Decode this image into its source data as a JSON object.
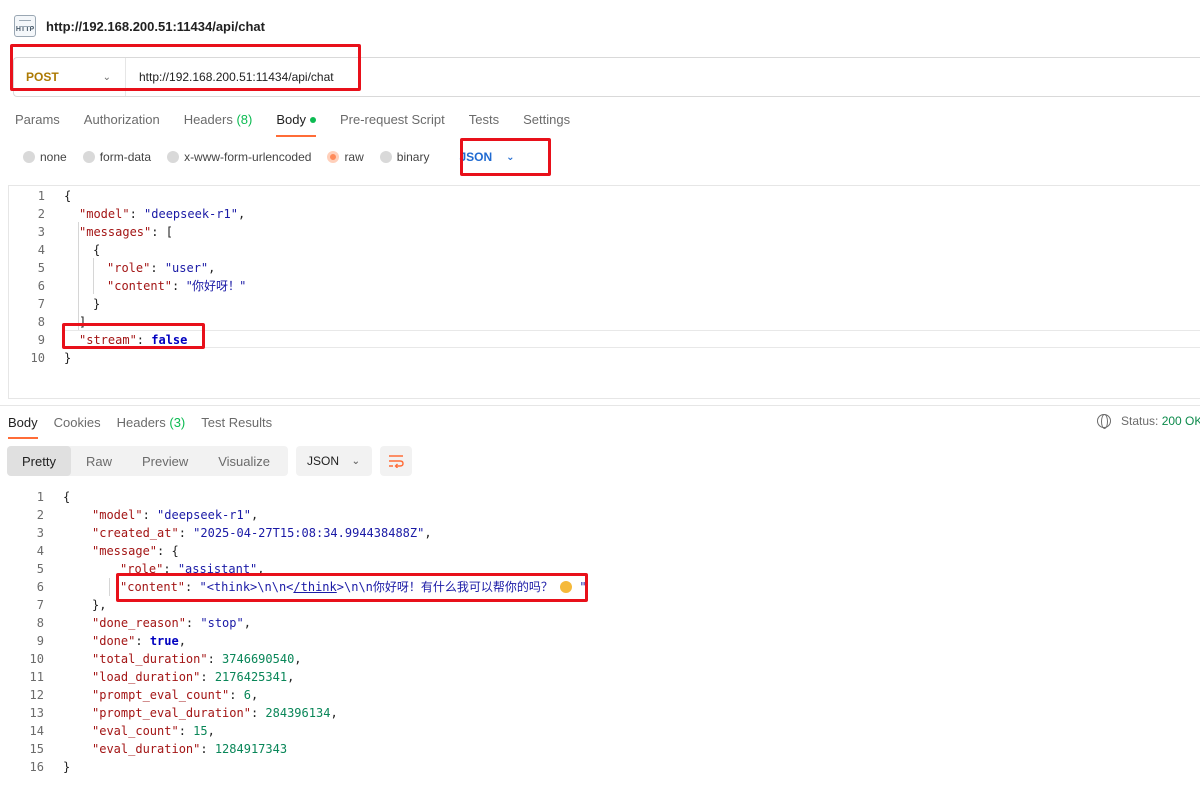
{
  "request": {
    "title": "http://192.168.200.51:11434/api/chat",
    "icon_label": "HTTP",
    "method": "POST",
    "url": "http://192.168.200.51:11434/api/chat"
  },
  "tabs": {
    "params": "Params",
    "authorization": "Authorization",
    "headers": "Headers",
    "headers_count": "(8)",
    "body": "Body",
    "prerequest": "Pre-request Script",
    "tests": "Tests",
    "settings": "Settings"
  },
  "body_types": {
    "none": "none",
    "form_data": "form-data",
    "urlencoded": "x-www-form-urlencoded",
    "raw": "raw",
    "binary": "binary",
    "format": "JSON"
  },
  "request_body": {
    "line_numbers": [
      "1",
      "2",
      "3",
      "4",
      "5",
      "6",
      "7",
      "8",
      "9",
      "10"
    ],
    "model_key": "\"model\"",
    "model_val": "\"deepseek-r1\"",
    "messages_key": "\"messages\"",
    "role_key": "\"role\"",
    "role_val": "\"user\"",
    "content_key": "\"content\"",
    "content_val": "\"你好呀！\"",
    "stream_key": "\"stream\"",
    "stream_val": "false"
  },
  "response_tabs": {
    "body": "Body",
    "cookies": "Cookies",
    "headers": "Headers",
    "headers_count": "(3)",
    "test_results": "Test Results"
  },
  "status": {
    "label": "Status:",
    "value": "200 OK"
  },
  "view_modes": {
    "pretty": "Pretty",
    "raw": "Raw",
    "preview": "Preview",
    "visualize": "Visualize",
    "format": "JSON"
  },
  "response_body": {
    "line_numbers": [
      "1",
      "2",
      "3",
      "4",
      "5",
      "6",
      "7",
      "8",
      "9",
      "10",
      "11",
      "12",
      "13",
      "14",
      "15",
      "16"
    ],
    "model_key": "\"model\"",
    "model_val": "\"deepseek-r1\"",
    "created_key": "\"created_at\"",
    "created_val": "\"2025-04-27T15:08:34.994438488Z\"",
    "message_key": "\"message\"",
    "role_key": "\"role\"",
    "role_val": "\"assistant\"",
    "content_key": "\"content\"",
    "content_prefix": "\"<think>\\n\\n<",
    "content_link": "/think",
    "content_mid": ">\\n\\n",
    "content_text": "你好呀！有什么我可以帮你的吗？",
    "content_end": "\"",
    "done_reason_key": "\"done_reason\"",
    "done_reason_val": "\"stop\"",
    "done_key": "\"done\"",
    "done_val": "true",
    "total_duration_key": "\"total_duration\"",
    "total_duration_val": "3746690540",
    "load_duration_key": "\"load_duration\"",
    "load_duration_val": "2176425341",
    "prompt_eval_count_key": "\"prompt_eval_count\"",
    "prompt_eval_count_val": "6",
    "prompt_eval_duration_key": "\"prompt_eval_duration\"",
    "prompt_eval_duration_val": "284396134",
    "eval_count_key": "\"eval_count\"",
    "eval_count_val": "15",
    "eval_duration_key": "\"eval_duration\"",
    "eval_duration_val": "1284917343"
  },
  "colors": {
    "accent": "#ff6c37",
    "highlight_box": "#e8101a",
    "method": "#ad7a03",
    "status_ok": "#0c8a4b"
  }
}
